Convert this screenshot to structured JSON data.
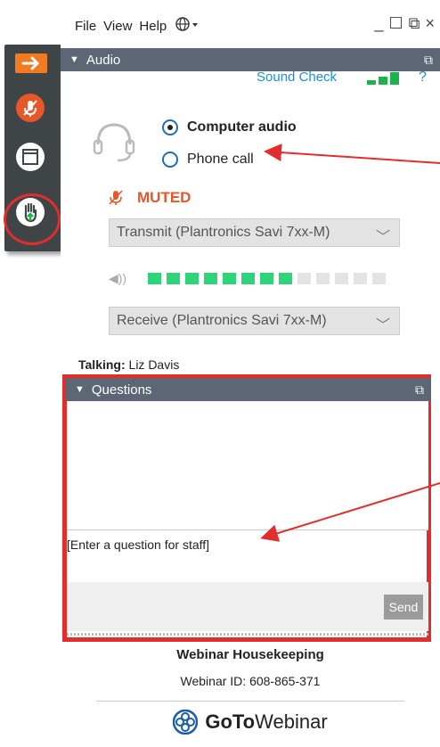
{
  "menu": {
    "file": "File",
    "view": "View",
    "help": "Help"
  },
  "window_controls": {
    "minimize": "_",
    "maximize": "☐",
    "restore": "⧉",
    "close": "×"
  },
  "audio": {
    "header": "Audio",
    "sound_check": "Sound Check",
    "help": "?",
    "options": [
      "Computer audio",
      "Phone call"
    ],
    "selected_option": "Computer audio",
    "muted_label": "MUTED",
    "transmit_device": "Transmit (Plantronics Savi 7xx-M)",
    "receive_device": "Receive (Plantronics Savi 7xx-M)",
    "speaker_level": 0.62,
    "talking_label": "Talking:",
    "talking_name": "Liz Davis"
  },
  "questions": {
    "header": "Questions",
    "input_text": "[Enter a question for staff]",
    "send_label": "Send"
  },
  "footer": {
    "title": "Webinar Housekeeping",
    "webinar_id": "Webinar ID: 608-865-371",
    "brand_go": "GoTo",
    "brand_rest": "Webinar"
  },
  "colors": {
    "accent": "#e32d2d",
    "header_bar": "#5d6675",
    "link": "#1b8ee0",
    "muted": "#e8572a",
    "meter_on": "#2fd37a"
  }
}
